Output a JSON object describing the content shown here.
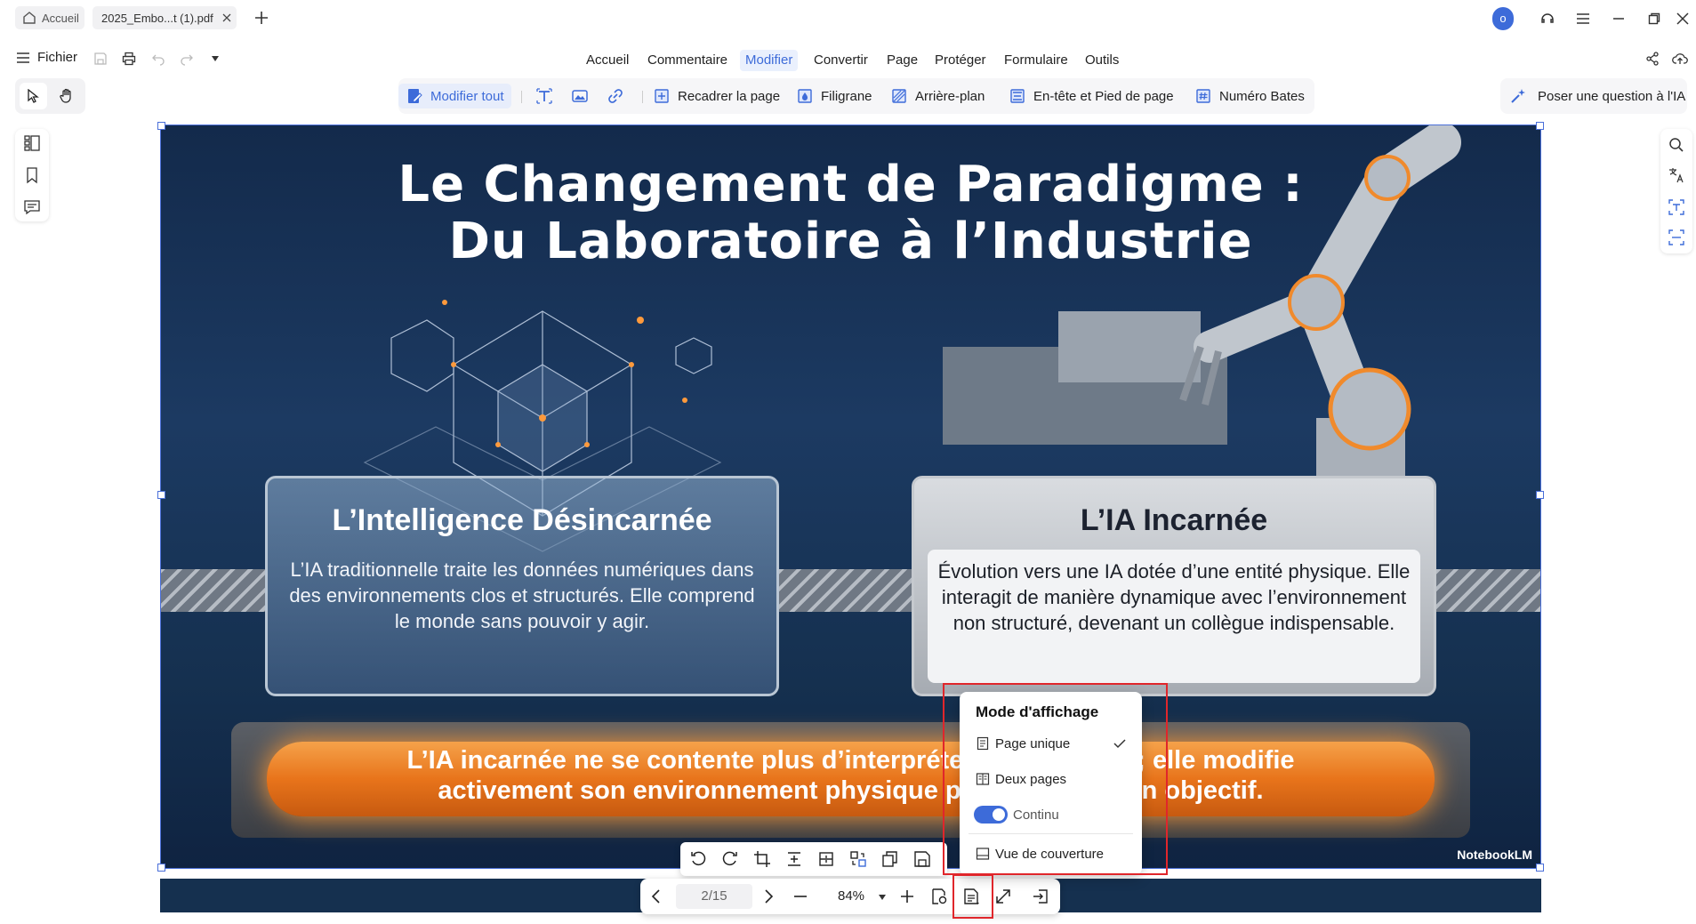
{
  "tabs": {
    "home_label": "Accueil",
    "doc_label": "2025_Embo...t (1).pdf"
  },
  "account": {
    "avatar_initial": "o"
  },
  "file_menu": {
    "label": "Fichier"
  },
  "main_menu": [
    "Accueil",
    "Commentaire",
    "Modifier",
    "Convertir",
    "Page",
    "Protéger",
    "Formulaire",
    "Outils"
  ],
  "active_menu": "Modifier",
  "toolbar": {
    "edit_all": "Modifier tout",
    "crop_page": "Recadrer la page",
    "watermark": "Filigrane",
    "background": "Arrière-plan",
    "header_footer": "En-tête et Pied de page",
    "bates": "Numéro Bates"
  },
  "ask_ai": "Poser une question à l'IA",
  "slide": {
    "title_line1": "Le Changement de Paradigme :",
    "title_line2": "Du Laboratoire à l’Industrie",
    "left_heading": "L’Intelligence Désincarnée",
    "left_body": "L’IA traditionnelle traite les données numériques dans des environnements clos et structurés. Elle comprend le monde sans pouvoir y agir.",
    "right_heading": "L’IA Incarnée",
    "right_body": "Évolution vers une IA dotée d’une entité physique. Elle interagit de manière dynamique avec l’environnement non structuré, devenant un collègue indispensable.",
    "banner_line1": "L’IA incarnée ne se contente plus d’interpréter les données ; elle modifie",
    "banner_line2": "activement son environnement physique pour atteindre un objectif.",
    "watermark_logo": "NotebookLM"
  },
  "nav": {
    "page_indicator": "2/15",
    "zoom_level": "84%"
  },
  "view_mode_popup": {
    "title": "Mode d'affichage",
    "single_page": "Page unique",
    "single_page_checked": true,
    "two_pages": "Deux pages",
    "continuous": "Continu",
    "continuous_on": true,
    "cover_view": "Vue de couverture"
  },
  "colors": {
    "accent": "#3d6bd9",
    "highlight_box": "#e0262b",
    "slide_bg": "#1c3a62",
    "banner_orange": "#e8741b"
  }
}
